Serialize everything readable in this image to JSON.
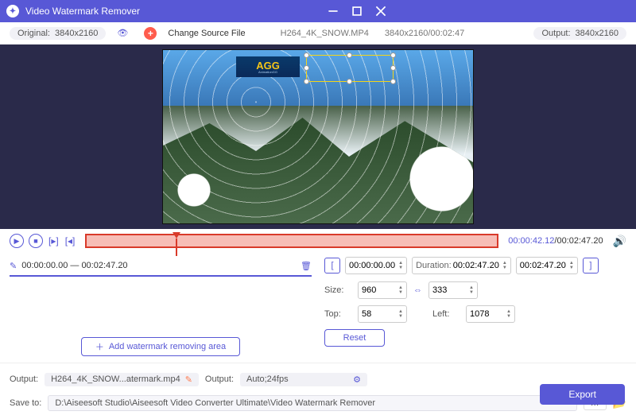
{
  "titlebar": {
    "title": "Video Watermark Remover"
  },
  "sourcebar": {
    "original_label": "Original:",
    "original_res": "3840x2160",
    "change_source": "Change Source File",
    "filename": "H264_4K_SNOW.MP4",
    "filemeta": "3840x2160/00:02:47",
    "output_label": "Output:",
    "output_res": "3840x2160"
  },
  "preview": {
    "watermark_text": "AGG",
    "watermark_sub": "AnimationGG"
  },
  "transport": {
    "current": "00:00:42.12",
    "total": "/00:02:47.20"
  },
  "area": {
    "range": "00:00:00.00 — 00:02:47.20",
    "add_label": "Add watermark removing area"
  },
  "trim": {
    "start": "00:00:00.00",
    "duration_label": "Duration:",
    "duration": "00:02:47.20",
    "end": "00:02:47.20"
  },
  "size": {
    "label": "Size:",
    "w": "960",
    "h": "333",
    "top_label": "Top:",
    "top": "58",
    "left_label": "Left:",
    "left": "1078",
    "reset": "Reset"
  },
  "output": {
    "out_label": "Output:",
    "out_file": "H264_4K_SNOW...atermark.mp4",
    "fmt_label": "Output:",
    "fmt": "Auto;24fps",
    "save_label": "Save to:",
    "save_path": "D:\\Aiseesoft Studio\\Aiseesoft Video Converter Ultimate\\Video Watermark Remover",
    "export": "Export"
  }
}
